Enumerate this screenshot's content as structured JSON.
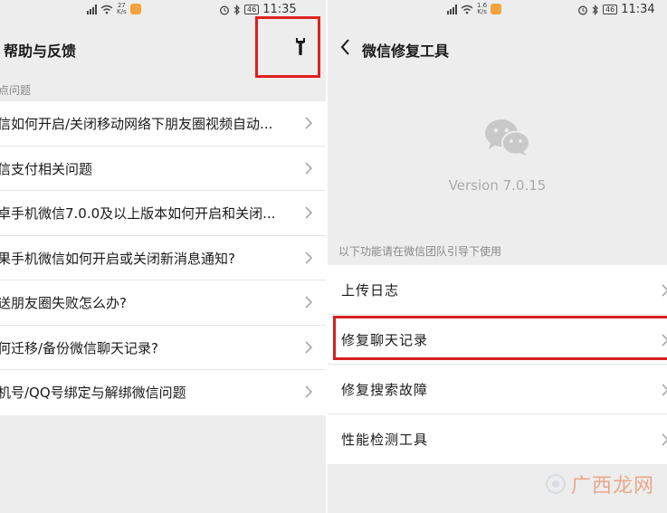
{
  "left": {
    "status": {
      "speed_value": "27",
      "speed_unit": "K/s",
      "battery": "46",
      "time": "11:35"
    },
    "title": "帮助与反馈",
    "section": "点问题",
    "items": [
      {
        "label": "信如何开启/关闭移动网络下朋友圈视频自动..."
      },
      {
        "label": "信支付相关问题"
      },
      {
        "label": "卓手机微信7.0.0及以上版本如何开启和关闭..."
      },
      {
        "label": "果手机微信如何开启或关闭新消息通知?"
      },
      {
        "label": "送朋友圈失败怎么办?"
      },
      {
        "label": "何迁移/备份微信聊天记录?"
      },
      {
        "label": "机号/QQ号绑定与解绑微信问题"
      }
    ],
    "wrench_icon": "wrench-icon"
  },
  "right": {
    "status": {
      "speed_value": "1.6",
      "speed_unit": "K/s",
      "battery": "46",
      "time": "11:34"
    },
    "title": "微信修复工具",
    "version": "Version 7.0.15",
    "section": "以下功能请在微信团队引导下使用",
    "items": [
      {
        "label": "上传日志"
      },
      {
        "label": "修复聊天记录"
      },
      {
        "label": "修复搜索故障"
      },
      {
        "label": "性能检测工具"
      }
    ]
  },
  "highlight_color": "#e02020",
  "watermark": "广西龙网"
}
